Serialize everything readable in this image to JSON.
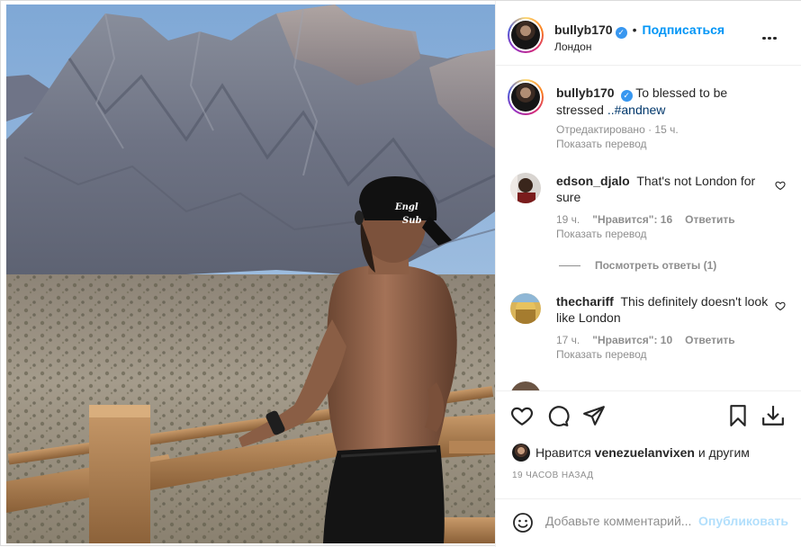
{
  "post": {
    "username": "bullyb170",
    "follow_label": "Подписаться",
    "location": "Лондон"
  },
  "caption": {
    "username": "bullyb170",
    "text": "To blessed to be stressed",
    "hashtag": "..#andnew",
    "edited": "Отредактировано · 15 ч.",
    "translate": "Показать перевод"
  },
  "comments": [
    {
      "username": "edson_djalo",
      "text": "That's not London for sure",
      "time": "19 ч.",
      "likes": "\"Нравится\": 16",
      "reply": "Ответить",
      "translate": "Показать перевод",
      "view_replies": "Посмотреть ответы (1)"
    },
    {
      "username": "thechariff",
      "text": "This definitely doesn't look like London",
      "time": "17 ч.",
      "likes": "\"Нравится\": 10",
      "reply": "Ответить",
      "translate": "Показать перевод"
    }
  ],
  "likes_line": {
    "prefix": "Нравится",
    "user": "venezuelanvixen",
    "suffix": "и другим"
  },
  "timestamp": "19 ЧАСОВ НАЗАД",
  "comment_box": {
    "placeholder": "Добавьте комментарий...",
    "publish_label": "Опубликовать"
  },
  "icons": [
    "heart-icon",
    "comment-icon",
    "share-icon",
    "bookmark-icon",
    "download-icon",
    "more-icon",
    "emoji-icon",
    "verified-icon"
  ],
  "colors": {
    "link": "#0095f6",
    "hashtag": "#00376b",
    "muted": "#8e8e8e",
    "publish_disabled": "#b2dffc"
  }
}
